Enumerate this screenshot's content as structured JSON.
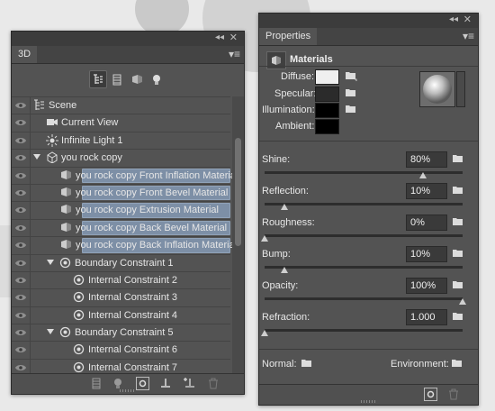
{
  "panel_3d": {
    "tab_label": "3D",
    "filters": [
      "scene-filter-icon",
      "mesh-filter-icon",
      "material-filter-icon",
      "light-filter-icon"
    ],
    "layers": [
      {
        "label": "Scene",
        "indent": 0,
        "icon": "scene-icon",
        "arrow": false,
        "selected": false
      },
      {
        "label": "Current View",
        "indent": 1,
        "icon": "camera-icon",
        "arrow": false,
        "selected": false
      },
      {
        "label": "Infinite Light 1",
        "indent": 1,
        "icon": "sun-icon",
        "arrow": false,
        "selected": false
      },
      {
        "label": "you rock copy",
        "indent": 1,
        "icon": "mesh-icon",
        "arrow": true,
        "selected": false
      },
      {
        "label": "you rock copy Front Inflation Material",
        "indent": 2,
        "icon": "material-icon",
        "arrow": false,
        "selected": true
      },
      {
        "label": "you rock copy Front Bevel Material",
        "indent": 2,
        "icon": "material-icon",
        "arrow": false,
        "selected": true
      },
      {
        "label": "you rock copy Extrusion Material",
        "indent": 2,
        "icon": "material-icon",
        "arrow": false,
        "selected": true
      },
      {
        "label": "you rock copy Back Bevel Material",
        "indent": 2,
        "icon": "material-icon",
        "arrow": false,
        "selected": true
      },
      {
        "label": "you rock copy Back Inflation Material",
        "indent": 2,
        "icon": "material-icon",
        "arrow": false,
        "selected": true
      },
      {
        "label": "Boundary Constraint 1",
        "indent": 2,
        "icon": "constraint-icon",
        "arrow": true,
        "selected": false
      },
      {
        "label": "Internal Constraint 2",
        "indent": 3,
        "icon": "constraint-icon",
        "arrow": false,
        "selected": false
      },
      {
        "label": "Internal Constraint 3",
        "indent": 3,
        "icon": "constraint-icon",
        "arrow": false,
        "selected": false
      },
      {
        "label": "Internal Constraint 4",
        "indent": 3,
        "icon": "constraint-icon",
        "arrow": false,
        "selected": false
      },
      {
        "label": "Boundary Constraint 5",
        "indent": 2,
        "icon": "constraint-icon",
        "arrow": true,
        "selected": false
      },
      {
        "label": "Internal Constraint 6",
        "indent": 3,
        "icon": "constraint-icon",
        "arrow": false,
        "selected": false
      },
      {
        "label": "Internal Constraint 7",
        "indent": 3,
        "icon": "constraint-icon",
        "arrow": false,
        "selected": false
      },
      {
        "label": "Internal Constraint 8",
        "indent": 3,
        "icon": "constraint-icon",
        "arrow": false,
        "selected": false
      }
    ],
    "bottom_icons": [
      "mesh-new-icon",
      "light-new-icon",
      "render-icon",
      "ground-icon",
      "add-light-icon",
      "trash-icon"
    ]
  },
  "properties": {
    "tab_label": "Properties",
    "section_title": "Materials",
    "diffuse_label": "Diffuse:",
    "specular_label": "Specular:",
    "illumination_label": "Illumination:",
    "ambient_label": "Ambient:",
    "colors": {
      "diffuse": "#efefef",
      "specular": "#2b2b2b",
      "illumination": "#000000",
      "ambient": "#000000"
    },
    "sliders": [
      {
        "label": "Shine:",
        "value": "80%",
        "level": 0.8
      },
      {
        "label": "Reflection:",
        "value": "10%",
        "level": 0.1
      },
      {
        "label": "Roughness:",
        "value": "0%",
        "level": 0.0
      },
      {
        "label": "Bump:",
        "value": "10%",
        "level": 0.1
      },
      {
        "label": "Opacity:",
        "value": "100%",
        "level": 1.0
      },
      {
        "label": "Refraction:",
        "value": "1.000",
        "level": 0.0
      }
    ],
    "normal_label": "Normal:",
    "environment_label": "Environment:"
  }
}
